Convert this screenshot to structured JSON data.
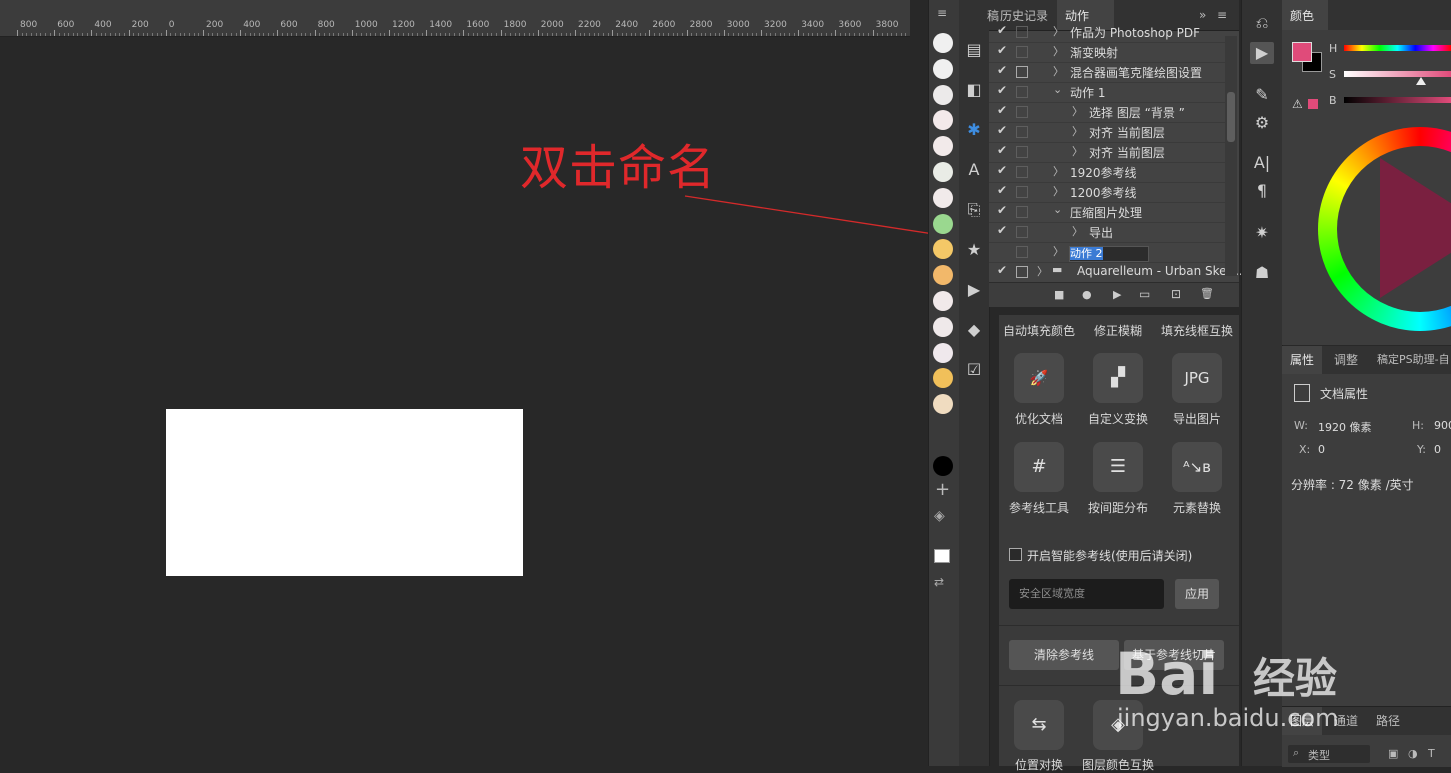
{
  "ruler": {
    "labels": [
      "800",
      "600",
      "400",
      "200",
      "0",
      "200",
      "400",
      "600",
      "800",
      "1000",
      "1200",
      "1400",
      "1600",
      "1800",
      "2000",
      "2200",
      "2400",
      "2600",
      "2800",
      "3000",
      "3200",
      "3400",
      "3600",
      "3800"
    ]
  },
  "annotation": {
    "text": "双击命名"
  },
  "swatches": [
    "#f0f0f0",
    "#f0f0f0",
    "#eceaea",
    "#f3e9ea",
    "#f2eaea",
    "#e9ece6",
    "#f1eaea",
    "#9ad88f",
    "#f4c867",
    "#f2b86a",
    "#f1e9ea",
    "#efe9ea",
    "#efe8ec",
    "#f1c05a",
    "#f0dcc0"
  ],
  "actions_panel": {
    "tab_partial": "稿定",
    "tabs": [
      "历史记录",
      "动作"
    ],
    "rows": [
      {
        "label": "作品为 Photoshop PDF",
        "indent": 0,
        "arrow": "〉",
        "dialog": false
      },
      {
        "label": "渐变映射",
        "indent": 0,
        "arrow": "〉",
        "dialog": false
      },
      {
        "label": "混合器画笔克隆绘图设置",
        "indent": 0,
        "arrow": "〉",
        "dialog": true
      },
      {
        "label": "动作 1",
        "indent": 0,
        "arrow": "⌄",
        "dialog": false
      },
      {
        "label": "选择 图层 “背景 ”",
        "indent": 1,
        "arrow": "〉",
        "dialog": false
      },
      {
        "label": "对齐 当前图层",
        "indent": 1,
        "arrow": "〉",
        "dialog": false
      },
      {
        "label": "对齐 当前图层",
        "indent": 1,
        "arrow": "〉",
        "dialog": false
      },
      {
        "label": "1920参考线",
        "indent": 0,
        "arrow": "〉",
        "dialog": false
      },
      {
        "label": "1200参考线",
        "indent": 0,
        "arrow": "〉",
        "dialog": false
      },
      {
        "label": "压缩图片处理",
        "indent": 0,
        "arrow": "⌄",
        "dialog": false
      },
      {
        "label": "导出",
        "indent": 1,
        "arrow": "〉",
        "dialog": false
      }
    ],
    "editing_value": "动作 2",
    "set_name": "Aquarelleum - Urban Sket...",
    "footer_icons": [
      "■",
      "●",
      "▶",
      "▭",
      "⊡",
      "🗑"
    ]
  },
  "plugin": {
    "headers": [
      "自动填充颜色",
      "修正模糊",
      "填充线框互换"
    ],
    "tools": [
      {
        "icon": "🚀",
        "label": "优化文档",
        "name": "optimize-doc"
      },
      {
        "icon": "▞",
        "label": "自定义变换",
        "name": "custom-transform"
      },
      {
        "icon": "JPG",
        "label": "导出图片",
        "name": "export-image"
      },
      {
        "icon": "#",
        "label": "参考线工具",
        "name": "guide-tool"
      },
      {
        "icon": "☰",
        "label": "按间距分布",
        "name": "distribute-spacing"
      },
      {
        "icon": "ᴬ↘ʙ",
        "label": "元素替换",
        "name": "element-replace"
      }
    ],
    "smart_guides_label": "开启智能参考线(使用后请关闭)",
    "safe_placeholder": "安全区域宽度",
    "apply_label": "应用",
    "clear_guides_label": "清除参考线",
    "guide_cut_label": "基于参考线切片",
    "bottom_tools": [
      {
        "label": "位置对换",
        "name": "swap-position"
      },
      {
        "label": "图层颜色互换",
        "name": "swap-layer-color"
      }
    ]
  },
  "color_panel": {
    "tab": "颜色",
    "fg_color": "#e04b7a",
    "bg_color": "#000000",
    "labels": {
      "h": "H",
      "s": "S",
      "b": "B"
    }
  },
  "properties": {
    "tabs": [
      "属性",
      "调整",
      "稿定PS助理-自"
    ],
    "doc_title": "文档属性",
    "w_label": "W:",
    "w_value": "1920 像素",
    "h_label": "H:",
    "h_value": "900",
    "x_label": "X:",
    "x_value": "0",
    "y_label": "Y:",
    "y_value": "0",
    "resolution": "分辨率 : 72 像素 /英寸"
  },
  "layers": {
    "tabs": [
      "图层",
      "通道",
      "路径"
    ],
    "filter": "类型"
  },
  "watermark": {
    "brand": "Bai",
    "brand_cn": "经验",
    "url": "jingyan.baidu.com"
  }
}
